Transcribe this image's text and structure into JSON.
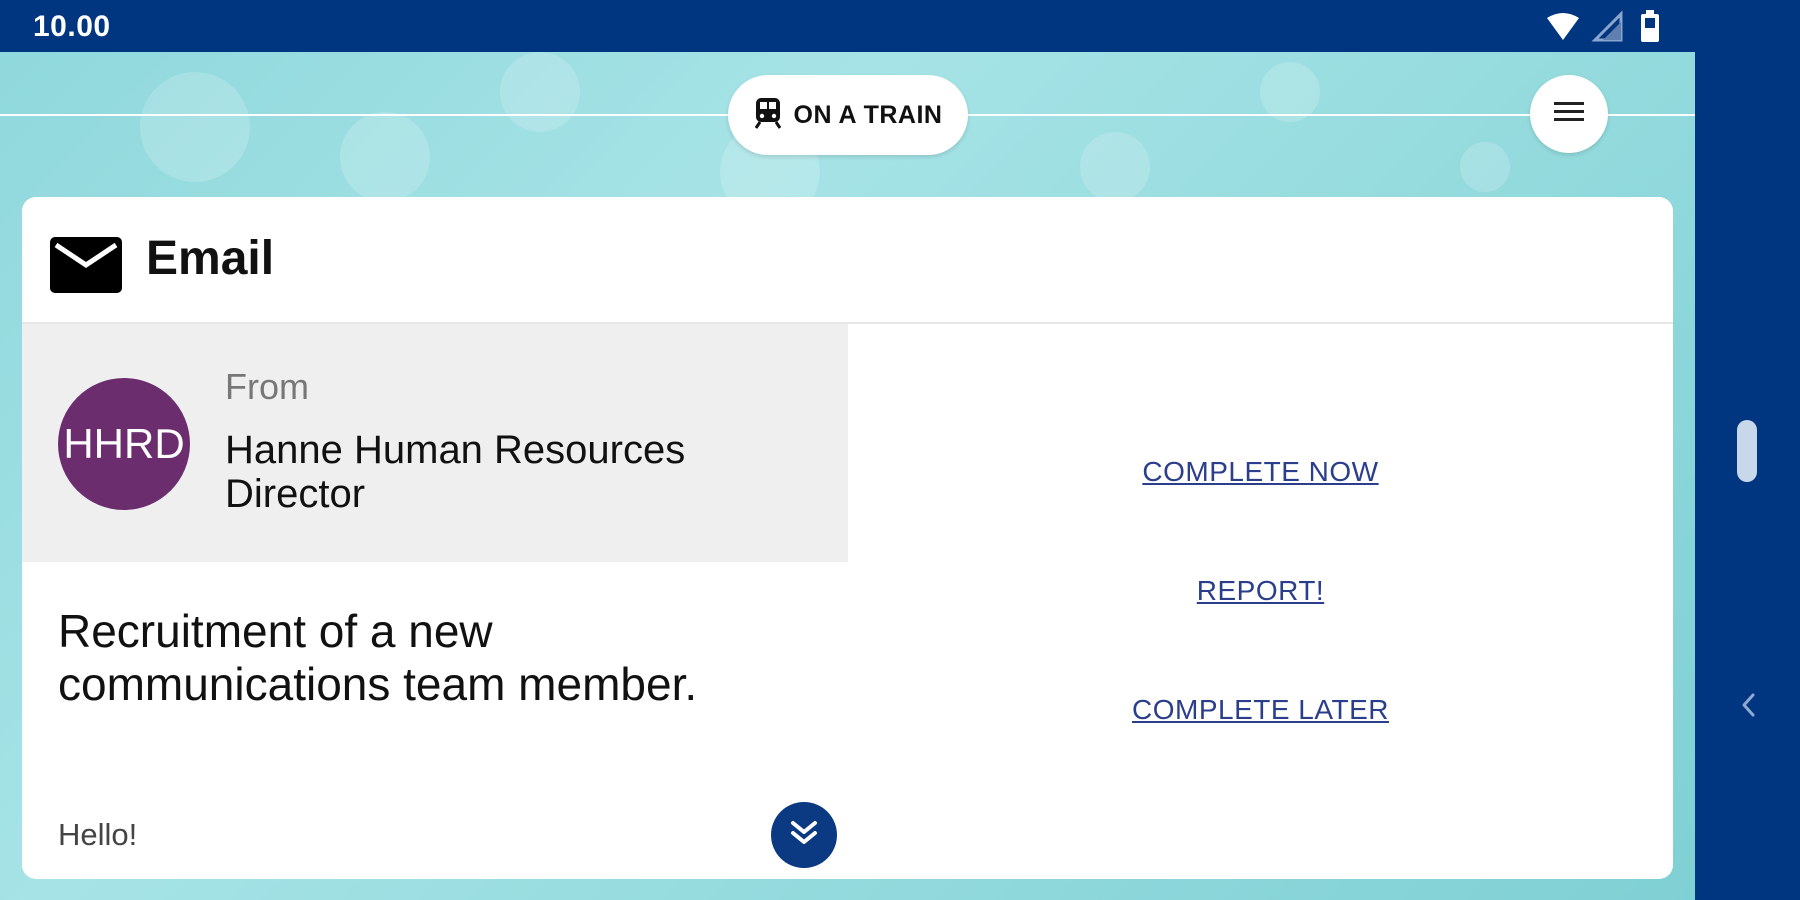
{
  "status_bar": {
    "time": "10.00",
    "icons": [
      "wifi-icon",
      "cellular-signal-icon",
      "battery-icon"
    ]
  },
  "header": {
    "status_pill": {
      "icon": "train-icon",
      "label": "ON A TRAIN"
    },
    "menu_icon": "hamburger-menu-icon"
  },
  "card": {
    "icon": "envelope-icon",
    "title": "Email",
    "sender": {
      "avatar_initials": "HHRD",
      "from_label": "From",
      "name": "Hanne Human Resources Director"
    },
    "subject": "Recruitment of a new communications team member.",
    "greeting": "Hello!",
    "actions": {
      "complete_now": "COMPLETE NOW",
      "report": "REPORT!",
      "complete_later": "COMPLETE LATER"
    },
    "expand_icon": "double-chevron-down-icon"
  },
  "side_rail": {
    "back_icon": "chevron-left-icon"
  },
  "colors": {
    "status_bar": "#003580",
    "avatar": "#6b2d6e",
    "link": "#2b3e8c",
    "expand_button": "#0b3a82",
    "sender_panel": "#efefef"
  }
}
